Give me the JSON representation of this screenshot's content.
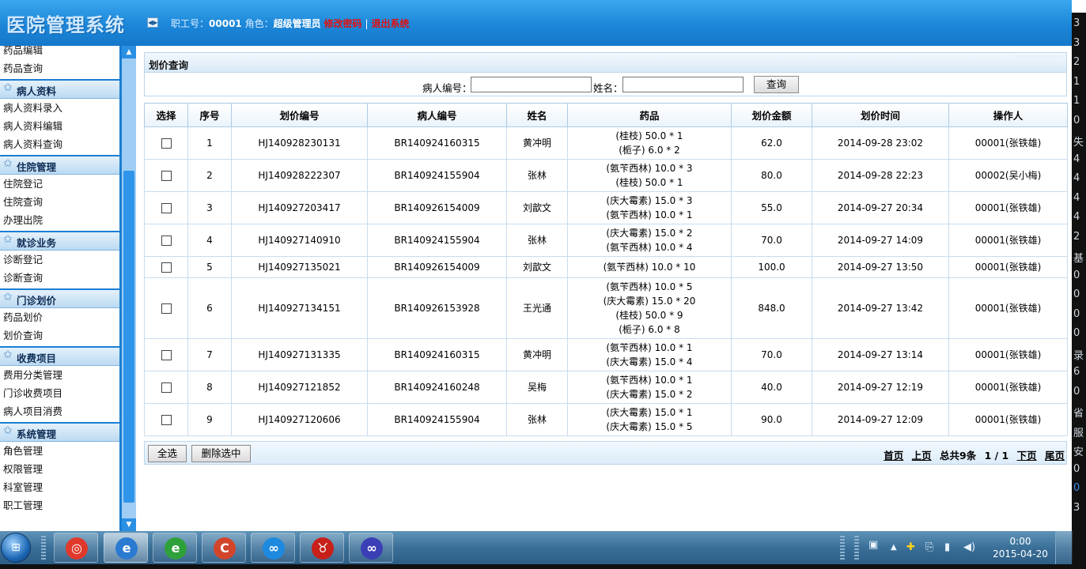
{
  "header": {
    "app_title": "医院管理系统",
    "toggle_icon": "collapse-toggle-icon",
    "staff_id_label": "职工号：",
    "staff_id_value": "00001",
    "role_label": "角色：",
    "role_value": "超级管理员",
    "change_password": "修改密码",
    "divider": "|",
    "logout": "退出系统"
  },
  "sidebar": {
    "top_items": [
      "药品编辑",
      "药品查询"
    ],
    "groups": [
      {
        "title": "病人资料",
        "items": [
          "病人资料录入",
          "病人资料编辑",
          "病人资料查询"
        ]
      },
      {
        "title": "住院管理",
        "items": [
          "住院登记",
          "住院查询",
          "办理出院"
        ]
      },
      {
        "title": "就诊业务",
        "items": [
          "诊断登记",
          "诊断查询"
        ]
      },
      {
        "title": "门诊划价",
        "items": [
          "药品划价",
          "划价查询"
        ]
      },
      {
        "title": "收费项目",
        "items": [
          "费用分类管理",
          "门诊收费项目",
          "病人项目消费"
        ]
      },
      {
        "title": "系统管理",
        "items": [
          "角色管理",
          "权限管理",
          "科室管理",
          "职工管理"
        ]
      }
    ]
  },
  "panel": {
    "title": "划价查询"
  },
  "search": {
    "patient_no_label": "病人编号：",
    "patient_no_value": "",
    "name_label": "姓名：",
    "name_value": "",
    "button": "查询"
  },
  "table": {
    "headers": [
      "选择",
      "序号",
      "划价编号",
      "病人编号",
      "姓名",
      "药品",
      "划价金额",
      "划价时间",
      "操作人"
    ],
    "rows": [
      {
        "seq": "1",
        "code": "HJ140928230131",
        "patient": "BR140924160315",
        "name": "黄冲明",
        "drugs": [
          "(桂枝) 50.0 * 1",
          "(栀子) 6.0 * 2"
        ],
        "amount": "62.0",
        "time": "2014-09-28 23:02",
        "operator": "00001(张铁雄)"
      },
      {
        "seq": "2",
        "code": "HJ140928222307",
        "patient": "BR140924155904",
        "name": "张林",
        "drugs": [
          "(氨苄西林) 10.0 * 3",
          "(桂枝) 50.0 * 1"
        ],
        "amount": "80.0",
        "time": "2014-09-28 22:23",
        "operator": "00002(吴小梅)"
      },
      {
        "seq": "3",
        "code": "HJ140927203417",
        "patient": "BR140926154009",
        "name": "刘歆文",
        "drugs": [
          "(庆大霉素) 15.0 * 3",
          "(氨苄西林) 10.0 * 1"
        ],
        "amount": "55.0",
        "time": "2014-09-27 20:34",
        "operator": "00001(张铁雄)"
      },
      {
        "seq": "4",
        "code": "HJ140927140910",
        "patient": "BR140924155904",
        "name": "张林",
        "drugs": [
          "(庆大霉素) 15.0 * 2",
          "(氨苄西林) 10.0 * 4"
        ],
        "amount": "70.0",
        "time": "2014-09-27 14:09",
        "operator": "00001(张铁雄)"
      },
      {
        "seq": "5",
        "code": "HJ140927135021",
        "patient": "BR140926154009",
        "name": "刘歆文",
        "drugs": [
          "(氨苄西林) 10.0 * 10"
        ],
        "amount": "100.0",
        "time": "2014-09-27 13:50",
        "operator": "00001(张铁雄)"
      },
      {
        "seq": "6",
        "code": "HJ140927134151",
        "patient": "BR140926153928",
        "name": "王光通",
        "drugs": [
          "(氨苄西林) 10.0 * 5",
          "(庆大霉素) 15.0 * 20",
          "(桂枝) 50.0 * 9",
          "(栀子) 6.0 * 8"
        ],
        "amount": "848.0",
        "time": "2014-09-27 13:42",
        "operator": "00001(张铁雄)"
      },
      {
        "seq": "7",
        "code": "HJ140927131335",
        "patient": "BR140924160315",
        "name": "黄冲明",
        "drugs": [
          "(氨苄西林) 10.0 * 1",
          "(庆大霉素) 15.0 * 4"
        ],
        "amount": "70.0",
        "time": "2014-09-27 13:14",
        "operator": "00001(张铁雄)"
      },
      {
        "seq": "8",
        "code": "HJ140927121852",
        "patient": "BR140924160248",
        "name": "吴梅",
        "drugs": [
          "(氨苄西林) 10.0 * 1",
          "(庆大霉素) 15.0 * 2"
        ],
        "amount": "40.0",
        "time": "2014-09-27 12:19",
        "operator": "00001(张铁雄)"
      },
      {
        "seq": "9",
        "code": "HJ140927120606",
        "patient": "BR140924155904",
        "name": "张林",
        "drugs": [
          "(庆大霉素) 15.0 * 1",
          "(庆大霉素) 15.0 * 5"
        ],
        "amount": "90.0",
        "time": "2014-09-27 12:09",
        "operator": "00001(张铁雄)"
      }
    ]
  },
  "footer": {
    "select_all": "全选",
    "delete_selected": "删除选中",
    "first_page": "首页",
    "prev_page": "上页",
    "total": "总共9条",
    "page_info": "1 / 1",
    "next_page": "下页",
    "last_page": "尾页"
  },
  "taskbar": {
    "start_icon": "windows-start-icon",
    "apps": [
      {
        "name": "chrome-icon",
        "glyph": "◎",
        "color": "#e0392b"
      },
      {
        "name": "internet-explorer-icon",
        "glyph": "e",
        "color": "#2a7ad2",
        "active": true
      },
      {
        "name": "ie-green-browser-icon",
        "glyph": "e",
        "color": "#2fa13a"
      },
      {
        "name": "ccleaner-icon",
        "glyph": "C",
        "color": "#d2452b"
      },
      {
        "name": "baidu-cloud-icon",
        "glyph": "∞",
        "color": "#1d8ae0"
      },
      {
        "name": "cow-app-icon",
        "glyph": "♉",
        "color": "#c8201a"
      },
      {
        "name": "infinity-app-icon",
        "glyph": "∞",
        "color": "#3b3fb5"
      }
    ],
    "tray_icons": [
      "image-tray-icon",
      "show-hidden-icons-arrow",
      "plus-tray-icon",
      "usb-tray-icon",
      "signal-tray-icon",
      "volume-tray-icon"
    ],
    "time": "0:00",
    "date": "2015-04-20"
  },
  "right_strip_chars": [
    "3",
    "3",
    "2",
    "1",
    "1",
    "0",
    "失",
    "4",
    "4",
    "4",
    "4",
    "2",
    "基",
    "0",
    "0",
    "0",
    "0",
    "录",
    "6",
    "0",
    "省",
    "服",
    "安",
    "0",
    "0",
    "3"
  ]
}
